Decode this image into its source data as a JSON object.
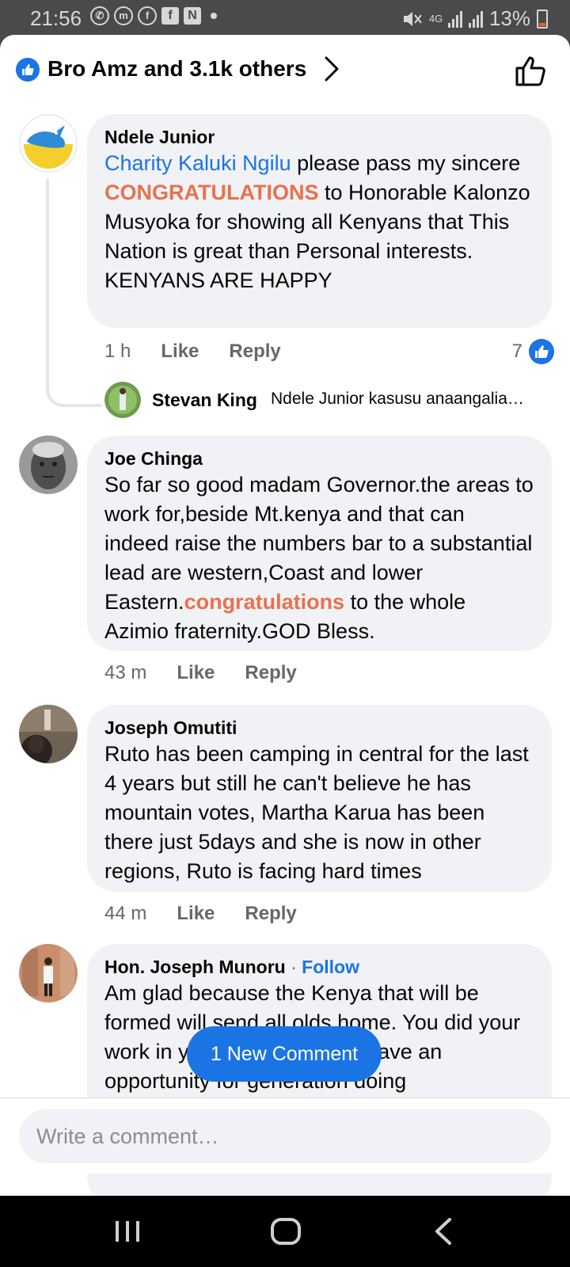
{
  "status_bar": {
    "time": "21:56",
    "battery": "13%",
    "network_label": "4G",
    "app_icons": [
      "whatsapp-icon",
      "messenger-icon",
      "facebook-icon",
      "facebook-square-icon",
      "n-icon",
      "dot-icon"
    ]
  },
  "header": {
    "reactions_summary": "Bro Amz and 3.1k others"
  },
  "comments": [
    {
      "author": "Ndele Junior",
      "mention": "Charity Kaluki Ngilu",
      "text_a": " please pass my sincere ",
      "highlight": "CONGRATULATIONS",
      "text_b": " to Honorable Kalonzo Musyoka for showing all Kenyans that This Nation is great than Personal interests. KENYANS ARE HAPPY",
      "time": "1 h",
      "like": "Like",
      "reply": "Reply",
      "reaction_count": "7",
      "reply_preview": {
        "author": "Stevan King",
        "text": "Ndele Junior kasusu anaangalia…"
      }
    },
    {
      "author": "Joe Chinga",
      "text_a": "So far so good madam Governor.the areas to work for,beside Mt.kenya and that can indeed raise the numbers bar to a substantial lead are western,Coast and lower Eastern.",
      "highlight": "congratulations",
      "text_b": " to the whole Azimio fraternity.GOD Bless.",
      "time": "43 m",
      "like": "Like",
      "reply": "Reply"
    },
    {
      "author": "Joseph Omutiti",
      "text": "Ruto has been camping in central for the last 4 years but still he can't believe he has mountain votes, Martha Karua has been there just 5days and she is now in other regions, Ruto is facing hard times",
      "time": "44 m",
      "like": "Like",
      "reply": "Reply"
    },
    {
      "author": "Hon. Joseph Munoru",
      "separator": " · ",
      "follow": "Follow",
      "text": "Am glad because the Kenya that will be formed will send all olds home. You did your work in your youthful age. Leave an opportunity for generation doing"
    }
  ],
  "new_comment_button": "1 New Comment",
  "composer": {
    "placeholder": "Write a comment…"
  },
  "nav": [
    "recents-icon",
    "home-icon",
    "back-icon"
  ],
  "colors": {
    "accent": "#1b74e4",
    "highlight": "#e8714d",
    "bubble": "#f0f2f5",
    "meta": "#65676b"
  }
}
